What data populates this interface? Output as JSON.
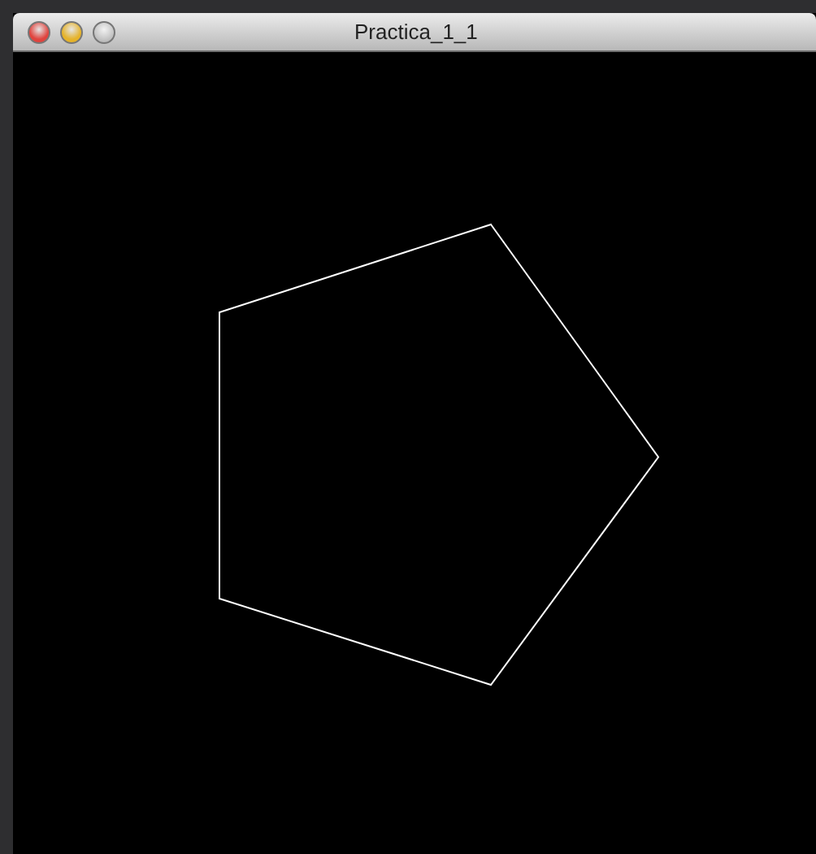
{
  "window": {
    "title": "Practica_1_1",
    "buttons": [
      {
        "kind": "close",
        "disabled": false
      },
      {
        "kind": "minimize",
        "disabled": false
      },
      {
        "kind": "zoom",
        "disabled": true
      }
    ]
  }
}
